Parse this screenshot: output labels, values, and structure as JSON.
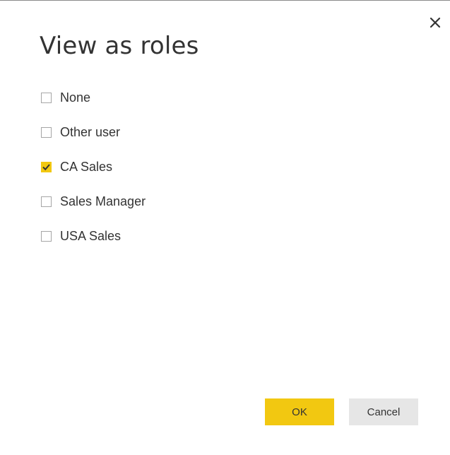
{
  "dialog": {
    "title": "View as roles",
    "close_icon": "close-icon",
    "roles": [
      {
        "label": "None",
        "checked": false
      },
      {
        "label": "Other user",
        "checked": false
      },
      {
        "label": "CA Sales",
        "checked": true
      },
      {
        "label": "Sales Manager",
        "checked": false
      },
      {
        "label": "USA Sales",
        "checked": false
      }
    ],
    "buttons": {
      "ok_label": "OK",
      "cancel_label": "Cancel"
    }
  },
  "colors": {
    "accent": "#f2c811",
    "secondary_button": "#e6e6e6",
    "text": "#333333",
    "checkbox_border": "#a6a6a6"
  }
}
